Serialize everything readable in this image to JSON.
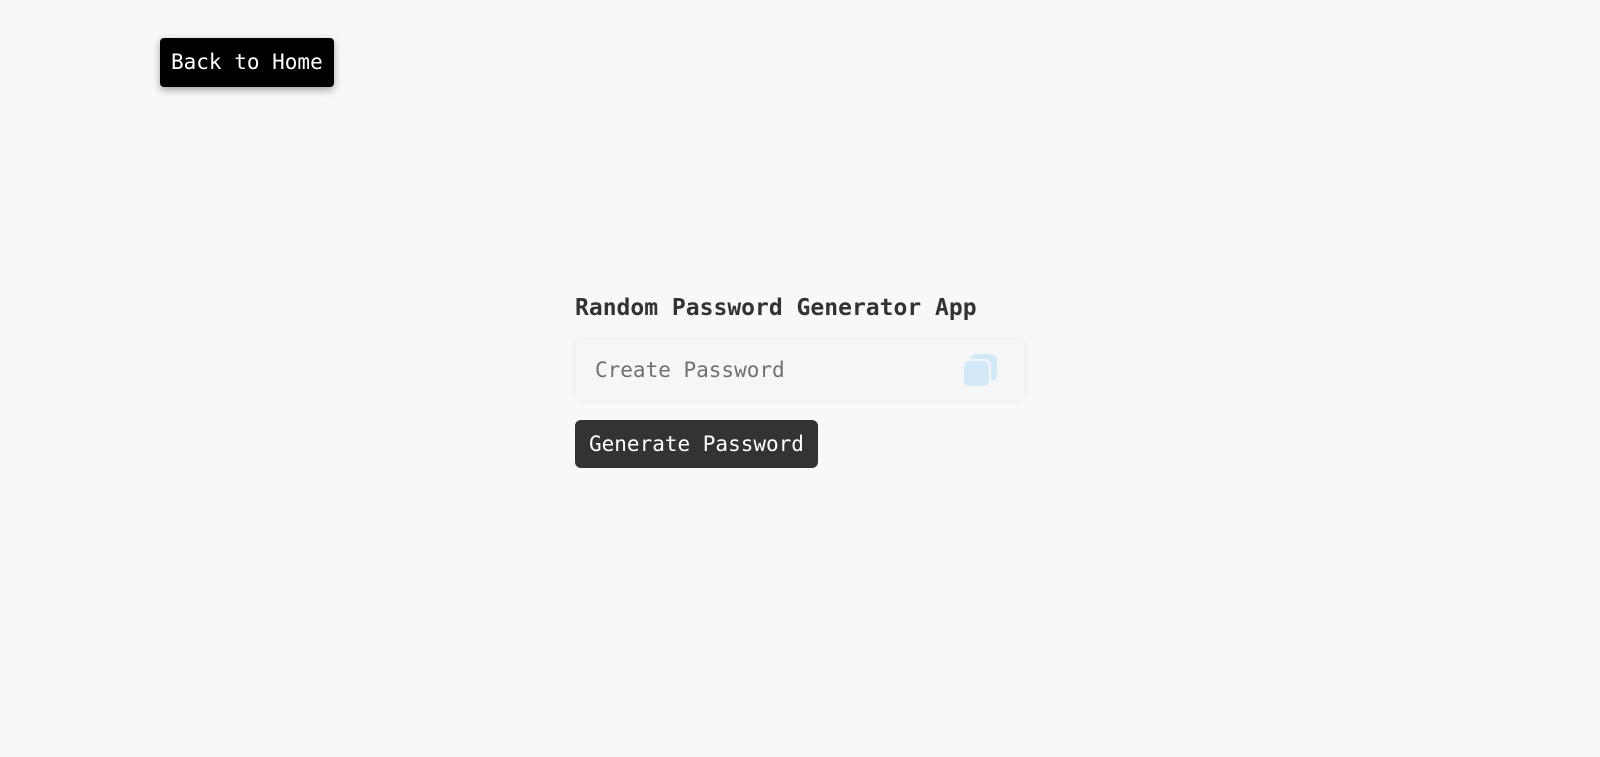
{
  "nav": {
    "back_label": "Back to Home"
  },
  "app": {
    "title": "Random Password Generator App",
    "password_field": {
      "value": "",
      "placeholder": "Create Password"
    },
    "copy_icon": "copy-icon",
    "generate_label": "Generate Password"
  },
  "colors": {
    "background": "#f8f8f8",
    "back_button_bg": "#000000",
    "generate_button_bg": "#333333",
    "copy_icon_tint": "#d3e9f8",
    "title_text": "#333333"
  }
}
